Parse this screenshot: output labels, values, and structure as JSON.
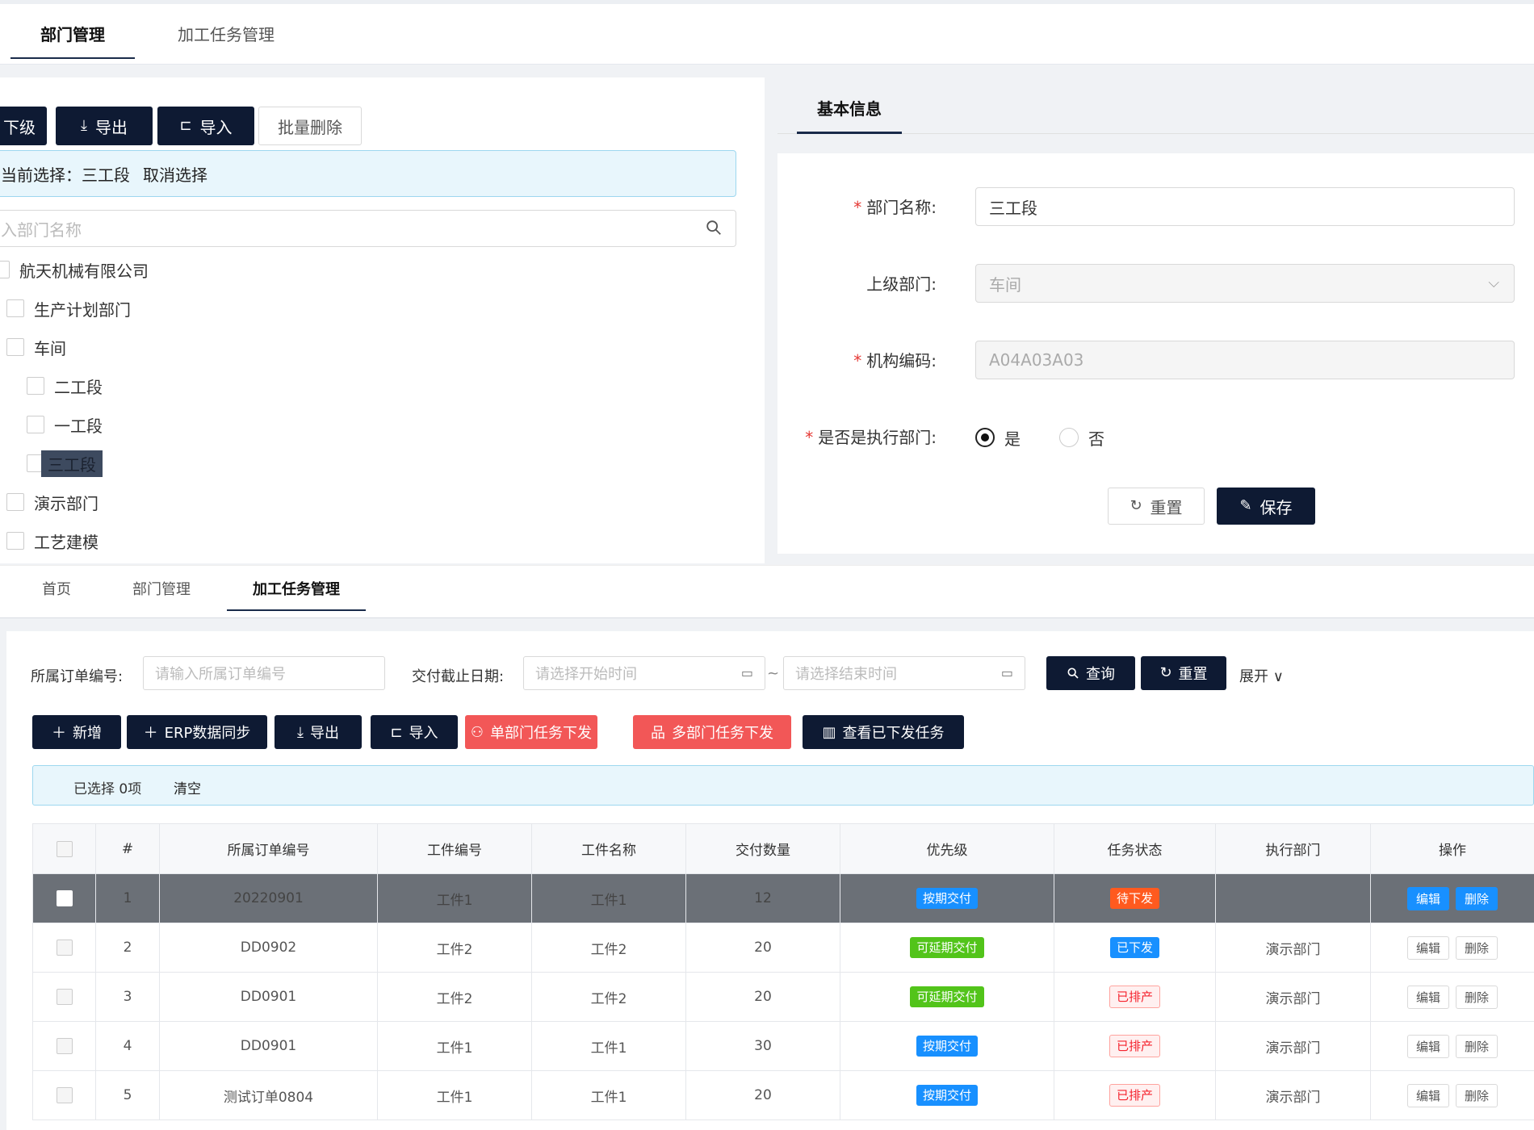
{
  "top_tabs": [
    {
      "label": "部门管理",
      "active": true
    },
    {
      "label": "加工任务管理",
      "active": false
    }
  ],
  "left": {
    "toolbar": {
      "add_child": "下级",
      "export": "导出",
      "import": "导入",
      "batch_delete": "批量删除"
    },
    "info": {
      "current_label": "当前选择：",
      "current_value": "三工段",
      "cancel": "取消选择"
    },
    "search_placeholder": "入部门名称",
    "tree": [
      {
        "label": "航天机械有限公司"
      },
      {
        "label": "生产计划部门"
      },
      {
        "label": "车间"
      },
      {
        "label": "二工段"
      },
      {
        "label": "一工段"
      },
      {
        "label": "三工段"
      },
      {
        "label": "演示部门"
      },
      {
        "label": "工艺建模"
      }
    ]
  },
  "right": {
    "tab": "基本信息",
    "fields": {
      "name_label": "部门名称:",
      "name_value": "三工段",
      "parent_label": "上级部门:",
      "parent_value": "车间",
      "code_label": "机构编码:",
      "code_value": "A04A03A03",
      "exec_label": "是否是执行部门:",
      "exec_yes": "是",
      "exec_no": "否"
    },
    "reset": "重置",
    "save": "保存"
  },
  "bottom": {
    "tabs": [
      {
        "label": "首页"
      },
      {
        "label": "部门管理"
      },
      {
        "label": "加工任务管理"
      }
    ],
    "filter": {
      "order_label": "所属订单编号:",
      "order_placeholder": "请输入所属订单编号",
      "date_label": "交付截止日期:",
      "start_placeholder": "请选择开始时间",
      "sep": "~",
      "end_placeholder": "请选择结束时间",
      "query": "查询",
      "reset": "重置",
      "expand": "展开"
    },
    "actions": {
      "add": "新增",
      "erp_sync": "ERP数据同步",
      "export": "导出",
      "import": "导入",
      "single_dispatch": "单部门任务下发",
      "multi_dispatch": "多部门任务下发",
      "view_dispatched": "查看已下发任务"
    },
    "selection": {
      "selected": "已选择 0项",
      "clear": "清空"
    },
    "table": {
      "headers": [
        "#",
        "所属订单编号",
        "工件编号",
        "工件名称",
        "交付数量",
        "优先级",
        "任务状态",
        "执行部门",
        "操作"
      ],
      "edit": "编辑",
      "delete": "删除",
      "rows": [
        {
          "no": "1",
          "order": "20220901",
          "part_no": "工件1",
          "part_name": "工件1",
          "qty": "12",
          "priority": "按期交付",
          "status": "待下发",
          "dept": ""
        },
        {
          "no": "2",
          "order": "DD0902",
          "part_no": "工件2",
          "part_name": "工件2",
          "qty": "20",
          "priority": "可延期交付",
          "status": "已下发",
          "dept": "演示部门"
        },
        {
          "no": "3",
          "order": "DD0901",
          "part_no": "工件2",
          "part_name": "工件2",
          "qty": "20",
          "priority": "可延期交付",
          "status": "已排产",
          "dept": "演示部门"
        },
        {
          "no": "4",
          "order": "DD0901",
          "part_no": "工件1",
          "part_name": "工件1",
          "qty": "30",
          "priority": "按期交付",
          "status": "已排产",
          "dept": "演示部门"
        },
        {
          "no": "5",
          "order": "测试订单0804",
          "part_no": "工件1",
          "part_name": "工件1",
          "qty": "20",
          "priority": "按期交付",
          "status": "已排产",
          "dept": "演示部门"
        }
      ]
    }
  },
  "colors": {
    "primary_dark": "#0e1a33",
    "danger": "#f25757",
    "info_bg": "#e8f6fc",
    "tag_blue": "#1890ff",
    "tag_green": "#52c41a",
    "tag_orange": "#ff5a1f"
  }
}
